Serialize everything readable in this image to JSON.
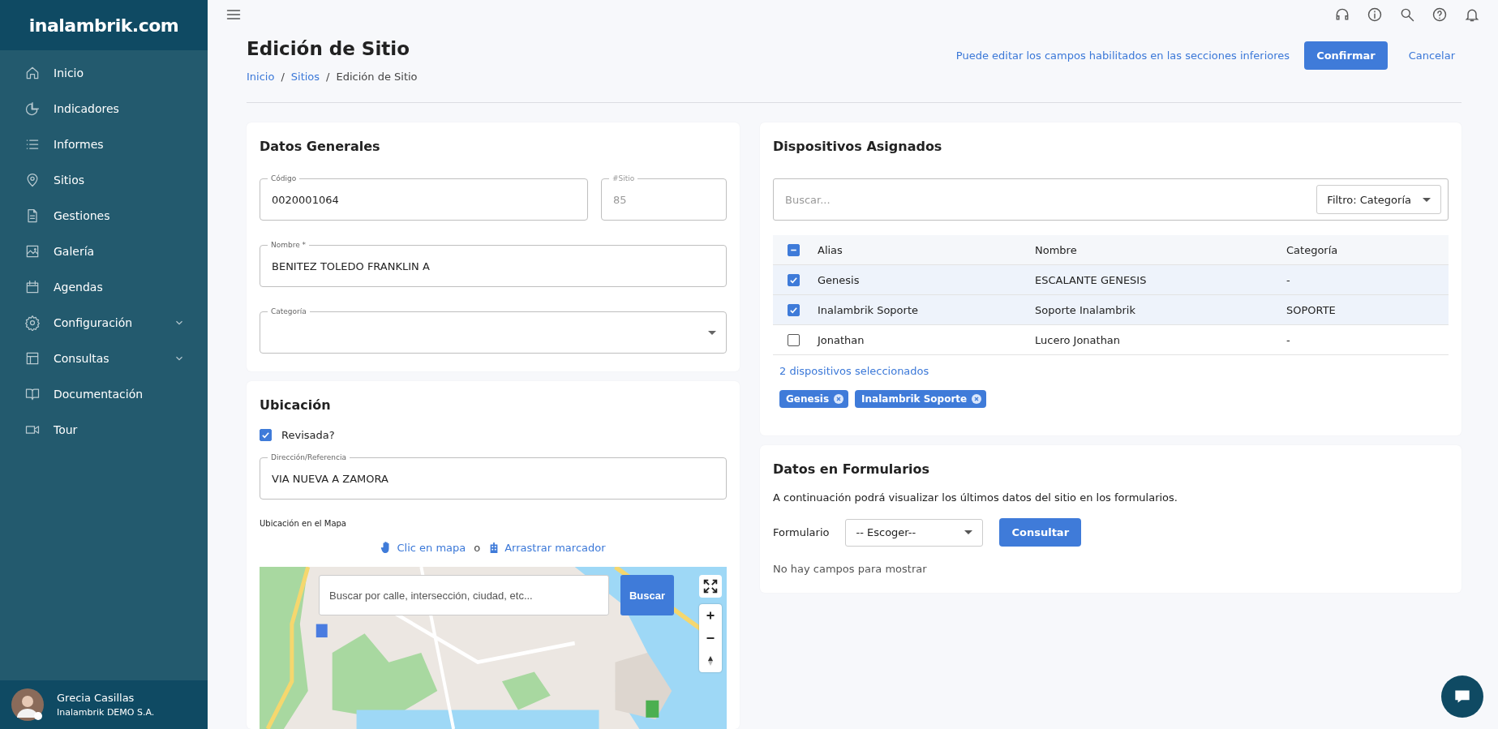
{
  "sidebar": {
    "logo": "inalambrik.com",
    "items": [
      {
        "label": "Inicio",
        "has_submenu": false
      },
      {
        "label": "Indicadores",
        "has_submenu": false
      },
      {
        "label": "Informes",
        "has_submenu": false
      },
      {
        "label": "Sitios",
        "has_submenu": false
      },
      {
        "label": "Gestiones",
        "has_submenu": false
      },
      {
        "label": "Galería",
        "has_submenu": false
      },
      {
        "label": "Agendas",
        "has_submenu": false
      },
      {
        "label": "Configuración",
        "has_submenu": true
      },
      {
        "label": "Consultas",
        "has_submenu": true
      },
      {
        "label": "Documentación",
        "has_submenu": false
      },
      {
        "label": "Tour",
        "has_submenu": false
      }
    ],
    "user": {
      "name": "Grecia Casillas",
      "company": "Inalambrik DEMO S.A."
    }
  },
  "page": {
    "title": "Edición de Sitio",
    "breadcrumb_separator": "/",
    "breadcrumb": [
      {
        "label": "Inicio",
        "link": true
      },
      {
        "label": "Sitios",
        "link": true
      },
      {
        "label": "Edición de Sitio",
        "link": false
      }
    ],
    "hint": "Puede editar los campos habilitados en las secciones inferiores",
    "buttons": [
      "Confirmar",
      "Cancelar"
    ]
  },
  "general": {
    "title": "Datos Generales",
    "code": {
      "label": "Código",
      "value": "0020001064",
      "disabled": false
    },
    "site_number": {
      "label": "#Sitio",
      "value": "85",
      "disabled": true
    },
    "name": {
      "label": "Nombre *",
      "value": "BENITEZ TOLEDO FRANKLIN A"
    },
    "category": {
      "label": "Categoría"
    }
  },
  "location": {
    "title": "Ubicación",
    "reviewed": {
      "label": "Revisada?",
      "checked": true
    },
    "address": {
      "label": "Dirección/Referencia",
      "value": "VIA NUEVA A ZAMORA"
    },
    "map_label": "Ubicación en el Mapa",
    "click_hint": "Clic en mapa",
    "separator": "o",
    "drag_hint": "Arrastrar marcador",
    "map": {
      "kind": "picture",
      "search_placeholder": "Buscar por calle, intersección, ciudad, etc...",
      "search_button": "Buscar"
    }
  },
  "devices": {
    "title": "Dispositivos Asignados",
    "search_placeholder": "Buscar...",
    "filter": "Filtro: Categoría",
    "header_indeterminate": true,
    "columns": [
      "Alias",
      "Nombre",
      "Categoría"
    ],
    "rows": [
      {
        "cells": [
          "Genesis",
          "ESCALANTE GENESIS",
          "-"
        ],
        "checked": true
      },
      {
        "cells": [
          "Inalambrik Soporte",
          "Soporte Inalambrik",
          "SOPORTE"
        ],
        "checked": true
      },
      {
        "cells": [
          "Jonathan",
          "Lucero Jonathan",
          "-"
        ],
        "checked": false
      }
    ],
    "selected_count": "2 dispositivos seleccionados",
    "chips": [
      "Genesis",
      "Inalambrik Soporte"
    ]
  },
  "forms": {
    "title": "Datos en Formularios",
    "description": "A continuación podrá visualizar los últimos datos del sitio en los formularios.",
    "select_label": "Formulario",
    "select_value": "-- Escoger--",
    "button": "Consultar",
    "empty": "No hay campos para mostrar"
  }
}
